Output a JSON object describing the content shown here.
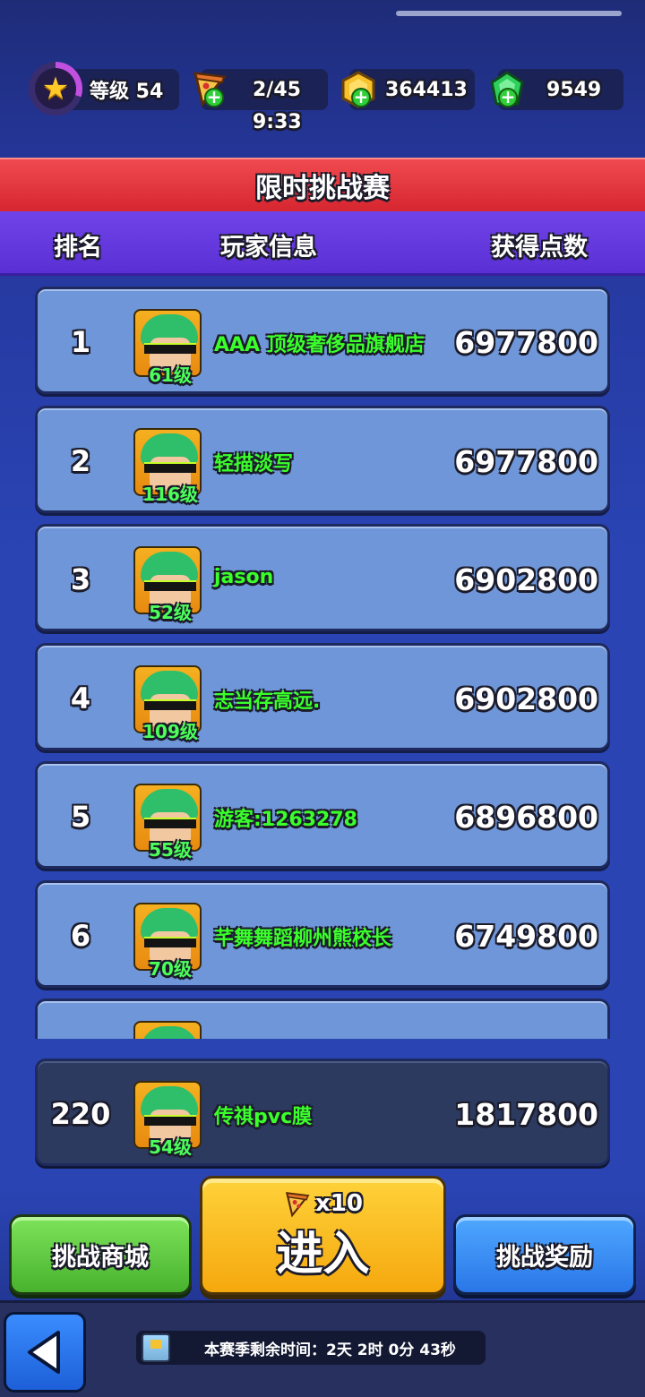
{
  "resources": {
    "level_label": "等级 54",
    "pizza_count": "2/45",
    "pizza_timer": "9:33",
    "gold": "364413",
    "gems": "9549"
  },
  "banner_title": "限时挑战赛",
  "table_headers": {
    "rank": "排名",
    "player_info": "玩家信息",
    "points": "获得点数"
  },
  "leaderboard": [
    {
      "rank": "1",
      "name": "AAA 顶级奢侈品旗舰店",
      "level": "61级",
      "score": "6977800"
    },
    {
      "rank": "2",
      "name": "轻描淡写",
      "level": "116级",
      "score": "6977800"
    },
    {
      "rank": "3",
      "name": "jason",
      "level": "52级",
      "score": "6902800"
    },
    {
      "rank": "4",
      "name": "志当存高远.",
      "level": "109级",
      "score": "6902800"
    },
    {
      "rank": "5",
      "name": "游客:1263278",
      "level": "55级",
      "score": "6896800"
    },
    {
      "rank": "6",
      "name": "芊舞舞蹈柳州熊校长",
      "level": "70级",
      "score": "6749800"
    },
    {
      "rank": "",
      "name": "",
      "level": "",
      "score": ""
    }
  ],
  "my_entry": {
    "rank": "220",
    "name": "传祺pvc膜",
    "level": "54级",
    "score": "1817800"
  },
  "buttons": {
    "shop": "挑战商城",
    "enter_cost": "x10",
    "enter": "进入",
    "reward": "挑战奖励"
  },
  "season_remaining": "本赛季剩余时间：2天 2时 0分 43秒",
  "colors": {
    "banner": "#d62630",
    "header": "#5a30d4",
    "row": "#6f96d8",
    "player_name": "#3aff2a",
    "btn_green": "#48b22e",
    "btn_yellow": "#f5a80e",
    "btn_blue": "#2a76e8"
  }
}
